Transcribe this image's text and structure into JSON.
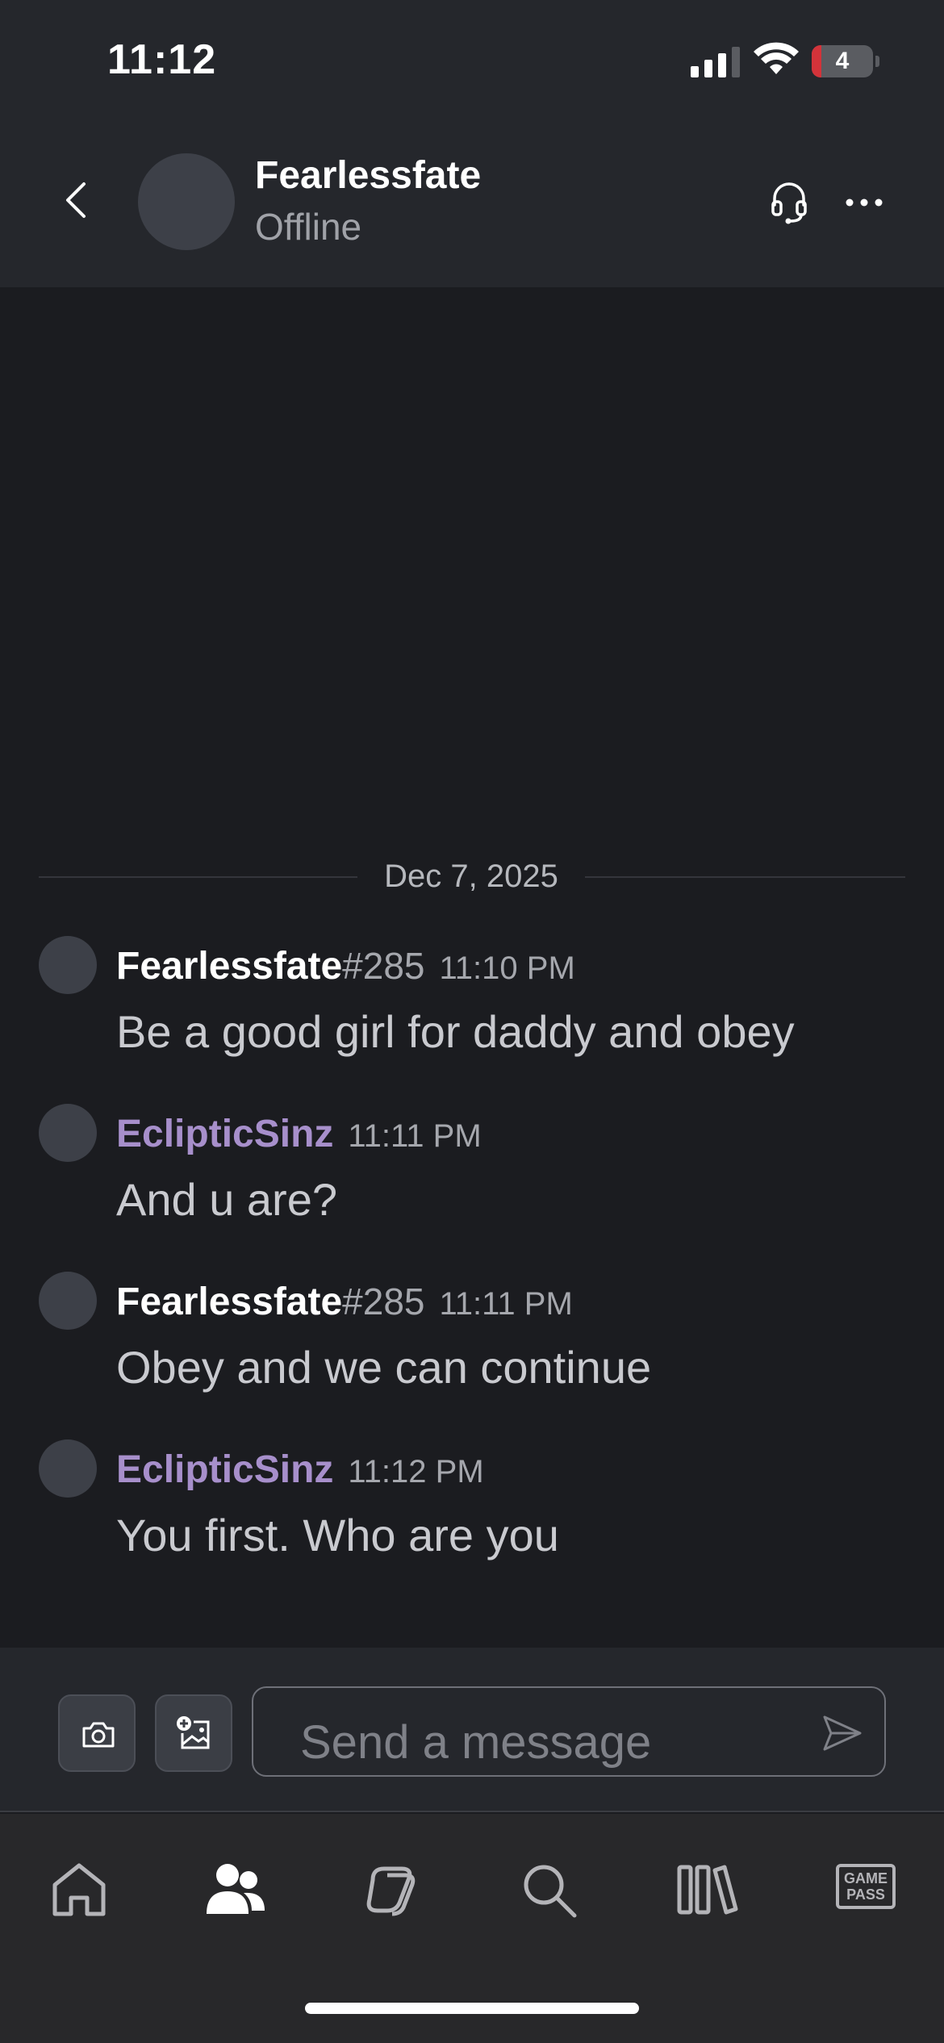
{
  "status_bar": {
    "time": "11:12",
    "battery_level": "4"
  },
  "header": {
    "contact_name": "Fearlessfate",
    "contact_status": "Offline"
  },
  "chat": {
    "date_divider": "Dec 7, 2025",
    "messages": [
      {
        "username": "Fearlessfate",
        "tag": "#285",
        "time": "11:10 PM",
        "text": "Be a good girl for daddy and obey",
        "name_color": "#ffffff"
      },
      {
        "username": "EclipticSinz",
        "tag": "",
        "time": "11:11 PM",
        "text": "And u are?",
        "name_color": "#a78fcb"
      },
      {
        "username": "Fearlessfate",
        "tag": "#285",
        "time": "11:11 PM",
        "text": "Obey and we can continue",
        "name_color": "#ffffff"
      },
      {
        "username": "EclipticSinz",
        "tag": "",
        "time": "11:12 PM",
        "text": "You first. Who are you",
        "name_color": "#a78fcb"
      }
    ]
  },
  "composer": {
    "placeholder": "Send a message",
    "camera_icon": "camera-icon",
    "image_icon": "add-image-icon",
    "send_icon": "send-icon"
  },
  "bottom_nav": {
    "items": [
      "home-icon",
      "friends-icon",
      "social-icon",
      "search-icon",
      "library-icon",
      "game-pass-icon"
    ],
    "active": "friends-icon",
    "gamepass_label_line1": "GAME",
    "gamepass_label_line2": "PASS"
  },
  "colors": {
    "accent_purple": "#a78fcb",
    "background": "#1b1c20",
    "header": "#25272c"
  }
}
